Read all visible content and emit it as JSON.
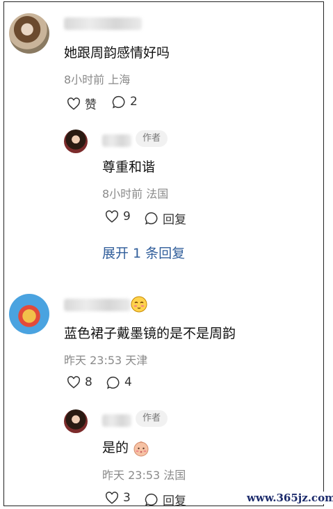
{
  "comments": [
    {
      "text": "她跟周韵感情好吗",
      "time": "8小时前",
      "location": "上海",
      "like_label": "赞",
      "reply_count": "2",
      "reply": {
        "author_tag": "作者",
        "text": "尊重和谐",
        "time": "8小时前",
        "location": "法国",
        "like_count": "9",
        "reply_label": "回复"
      },
      "expand_label": "展开 1 条回复"
    },
    {
      "text": "蓝色裙子戴墨镜的是不是周韵",
      "time": "昨天 23:53",
      "location": "天津",
      "like_count": "8",
      "reply_count": "4",
      "reply": {
        "author_tag": "作者",
        "text": "是的",
        "time": "昨天 23:53",
        "location": "法国",
        "like_count": "3",
        "reply_label": "回复"
      }
    }
  ],
  "watermark": "www.365jz.com",
  "icons": {
    "like": "heart-outline-icon",
    "reply": "speech-bubble-icon",
    "emoji_1": "blushing-face-emoji-icon",
    "emoji_2": "baby-face-emoji-icon"
  }
}
